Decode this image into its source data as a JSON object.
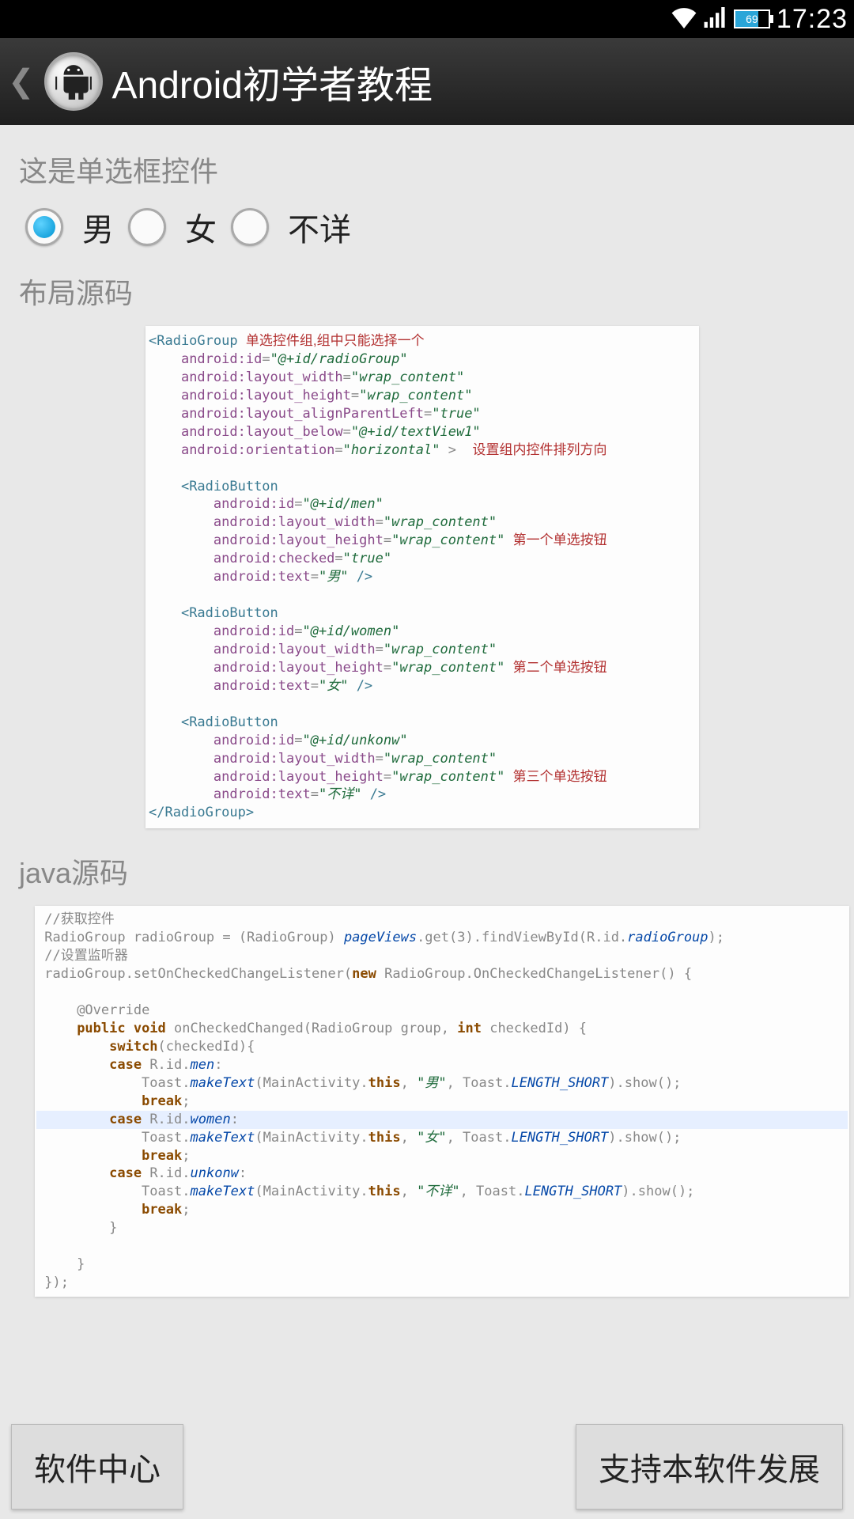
{
  "status": {
    "battery": "69",
    "time": "17:23"
  },
  "header": {
    "title": "Android初学者教程"
  },
  "main": {
    "radio_section_label": "这是单选框控件",
    "radios": [
      {
        "label": "男",
        "checked": true
      },
      {
        "label": "女",
        "checked": false
      },
      {
        "label": "不详",
        "checked": false
      }
    ],
    "layout_src_label": "布局源码",
    "java_src_label": "java源码",
    "xml_code": {
      "open_tag": "RadioGroup",
      "open_note": "单选控件组,组中只能选择一个",
      "attrs": [
        {
          "k": "android:id",
          "v": "\"@+id/radioGroup\""
        },
        {
          "k": "android:layout_width",
          "v": "\"wrap_content\""
        },
        {
          "k": "android:layout_height",
          "v": "\"wrap_content\""
        },
        {
          "k": "android:layout_alignParentLeft",
          "v": "\"true\""
        },
        {
          "k": "android:layout_below",
          "v": "\"@+id/textView1\""
        },
        {
          "k": "android:orientation",
          "v": "\"horizontal\"",
          "note": "设置组内控件排列方向",
          "close": " >"
        }
      ],
      "buttons": [
        {
          "note": "第一个单选按钮",
          "attrs": [
            {
              "k": "android:id",
              "v": "\"@+id/men\""
            },
            {
              "k": "android:layout_width",
              "v": "\"wrap_content\""
            },
            {
              "k": "android:layout_height",
              "v": "\"wrap_content\""
            },
            {
              "k": "android:checked",
              "v": "\"true\""
            },
            {
              "k": "android:text",
              "v": "\"男\"",
              "close": " />"
            }
          ]
        },
        {
          "note": "第二个单选按钮",
          "attrs": [
            {
              "k": "android:id",
              "v": "\"@+id/women\""
            },
            {
              "k": "android:layout_width",
              "v": "\"wrap_content\""
            },
            {
              "k": "android:layout_height",
              "v": "\"wrap_content\""
            },
            {
              "k": "android:text",
              "v": "\"女\"",
              "close": " />"
            }
          ]
        },
        {
          "note": "第三个单选按钮",
          "attrs": [
            {
              "k": "android:id",
              "v": "\"@+id/unkonw\""
            },
            {
              "k": "android:layout_width",
              "v": "\"wrap_content\""
            },
            {
              "k": "android:layout_height",
              "v": "\"wrap_content\""
            },
            {
              "k": "android:text",
              "v": "\"不详\"",
              "close": " />"
            }
          ]
        }
      ],
      "close_tag": "RadioGroup"
    },
    "java_code": {
      "c1": "//获取控件",
      "l1_a": "RadioGroup radioGroup = (RadioGroup) ",
      "l1_b": "pageViews",
      "l1_c": ".get(3).findViewById(R.id.",
      "l1_d": "radioGroup",
      "l1_e": ");",
      "c2": "//设置监听器",
      "l2_a": "radioGroup.setOnCheckedChangeListener(",
      "l2_b": "new",
      "l2_c": " RadioGroup.OnCheckedChangeListener() {",
      "override": "@Override",
      "m_a": "public void",
      "m_b": " onCheckedChanged(RadioGroup group, ",
      "m_c": "int",
      "m_d": " checkedId) {",
      "sw": "switch",
      "sw_b": "(checkedId){",
      "case": "case",
      "break": "break",
      "rid": " R.id.",
      "cases": [
        {
          "id": "men",
          "text": "\"男\""
        },
        {
          "id": "women",
          "text": "\"女\""
        },
        {
          "id": "unkonw",
          "text": "\"不详\""
        }
      ],
      "toast_a": "Toast.",
      "toast_b": "makeText",
      "toast_c": "(MainActivity.",
      "toast_d": "this",
      "toast_e": ", Toast.",
      "toast_f": "LENGTH_SHORT",
      "toast_g": ").show();",
      "end": "});"
    }
  },
  "footer": {
    "left": "软件中心",
    "right": "支持本软件发展"
  }
}
